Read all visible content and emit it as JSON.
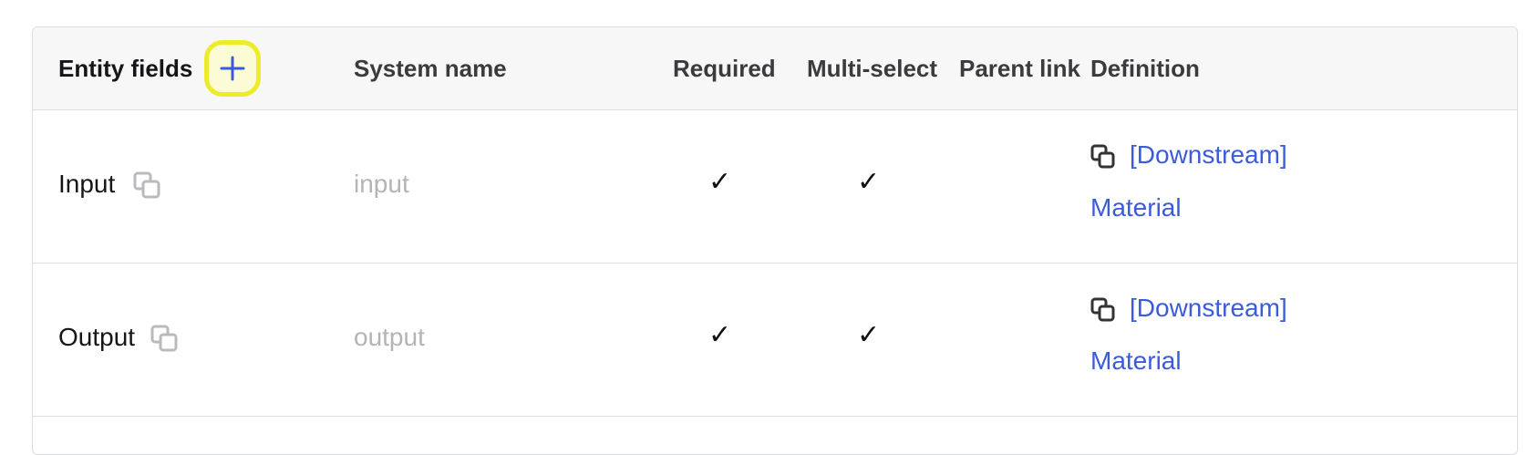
{
  "table": {
    "headers": {
      "entity_fields": "Entity fields",
      "system_name": "System name",
      "required": "Required",
      "multi_select": "Multi-select",
      "parent_link": "Parent link",
      "definition": "Definition"
    },
    "rows": [
      {
        "field": "Input",
        "system_name": "input",
        "required": "✓",
        "multi_select": "✓",
        "parent_link": "",
        "definition_line1": "[Downstream]",
        "definition_line2": "Material"
      },
      {
        "field": "Output",
        "system_name": "output",
        "required": "✓",
        "multi_select": "✓",
        "parent_link": "",
        "definition_line1": "[Downstream]",
        "definition_line2": "Material"
      }
    ]
  },
  "icons": {
    "add": "plus-icon",
    "copy": "copy-icon",
    "definition": "linked-copy-icon"
  },
  "colors": {
    "link": "#3b5bdb",
    "highlight": "#ecec2a",
    "header_bg": "#f7f7f8",
    "border": "#dcdde0"
  }
}
